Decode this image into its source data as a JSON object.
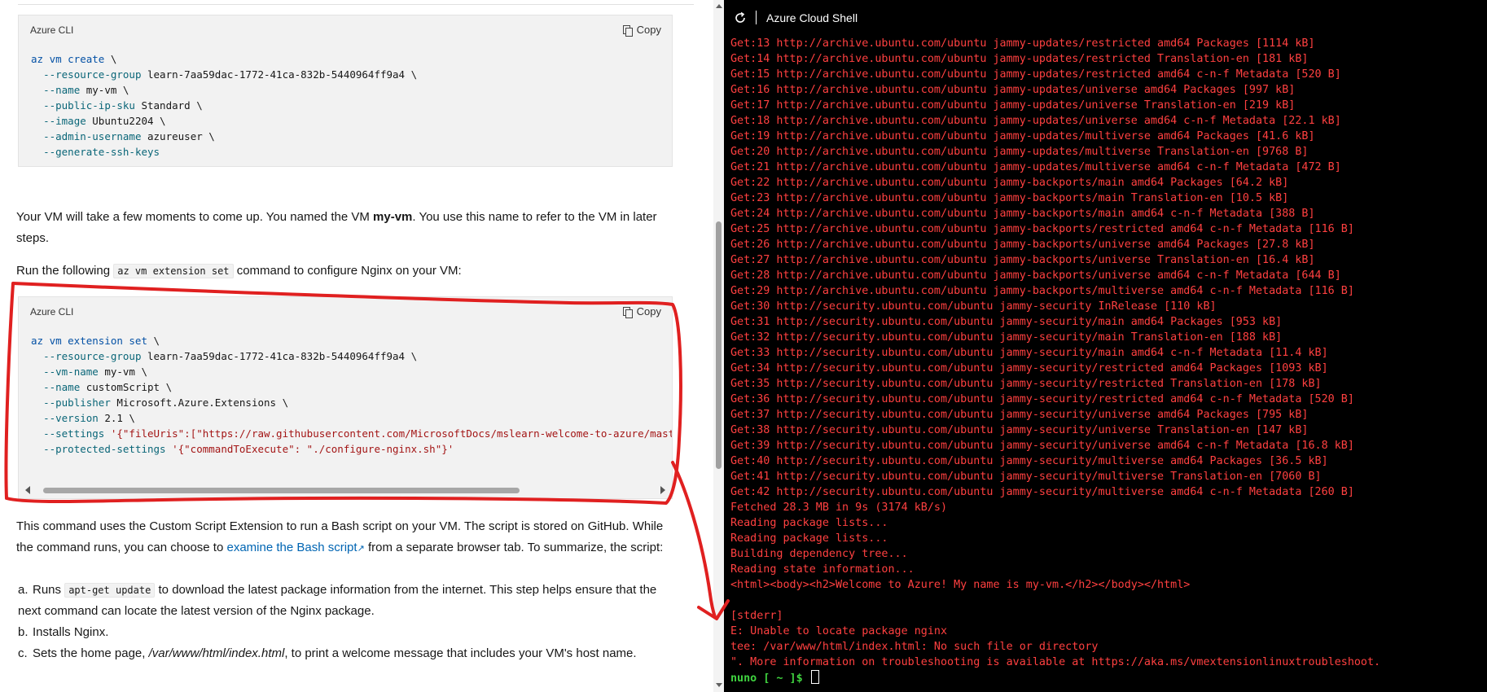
{
  "code1": {
    "lang": "Azure CLI",
    "copy": "Copy",
    "lines": [
      "az vm create \\",
      "  --resource-group learn-7aa59dac-1772-41ca-832b-5440964ff9a4 \\",
      "  --name my-vm \\",
      "  --public-ip-sku Standard \\",
      "  --image Ubuntu2204 \\",
      "  --admin-username azureuser \\",
      "  --generate-ssh-keys"
    ]
  },
  "para1": {
    "text_a": "Your VM will take a few moments to come up. You named the VM ",
    "bold": "my-vm",
    "text_b": ". You use this name to refer to the VM in later steps."
  },
  "para2": {
    "text_a": "Run the following ",
    "code": "az vm extension set",
    "text_b": " command to configure Nginx on your VM:"
  },
  "code2": {
    "lang": "Azure CLI",
    "copy": "Copy",
    "lines": [
      "az vm extension set \\",
      "  --resource-group learn-7aa59dac-1772-41ca-832b-5440964ff9a4 \\",
      "  --vm-name my-vm \\",
      "  --name customScript \\",
      "  --publisher Microsoft.Azure.Extensions \\",
      "  --version 2.1 \\",
      "  --settings '{\"fileUris\":[\"https://raw.githubusercontent.com/MicrosoftDocs/mslearn-welcome-to-azure/master/configure-nginx.sh\"]}' \\",
      "  --protected-settings '{\"commandToExecute\": \"./configure-nginx.sh\"}'"
    ]
  },
  "para3": {
    "text_a": "This command uses the Custom Script Extension to run a Bash script on your VM. The script is stored on GitHub. While the command runs, you can choose to ",
    "link": "examine the Bash script",
    "text_b": " from a separate browser tab. To summarize, the script:"
  },
  "list": [
    {
      "marker": "a.",
      "text_a": "Runs ",
      "code": "apt-get update",
      "text_b": " to download the latest package information from the internet. This step helps ensure that the next command can locate the latest version of the Nginx package."
    },
    {
      "marker": "b.",
      "text_a": "Installs Nginx.",
      "code": "",
      "text_b": ""
    },
    {
      "marker": "c.",
      "text_a": "Sets the home page, ",
      "code": "",
      "italic": "/var/www/html/index.html",
      "text_b": ", to print a welcome message that includes your VM's host name."
    }
  ],
  "shell": {
    "title": "Azure Cloud Shell",
    "lines": [
      "Get:13 http://archive.ubuntu.com/ubuntu jammy-updates/restricted amd64 Packages [1114 kB]",
      "Get:14 http://archive.ubuntu.com/ubuntu jammy-updates/restricted Translation-en [181 kB]",
      "Get:15 http://archive.ubuntu.com/ubuntu jammy-updates/restricted amd64 c-n-f Metadata [520 B]",
      "Get:16 http://archive.ubuntu.com/ubuntu jammy-updates/universe amd64 Packages [997 kB]",
      "Get:17 http://archive.ubuntu.com/ubuntu jammy-updates/universe Translation-en [219 kB]",
      "Get:18 http://archive.ubuntu.com/ubuntu jammy-updates/universe amd64 c-n-f Metadata [22.1 kB]",
      "Get:19 http://archive.ubuntu.com/ubuntu jammy-updates/multiverse amd64 Packages [41.6 kB]",
      "Get:20 http://archive.ubuntu.com/ubuntu jammy-updates/multiverse Translation-en [9768 B]",
      "Get:21 http://archive.ubuntu.com/ubuntu jammy-updates/multiverse amd64 c-n-f Metadata [472 B]",
      "Get:22 http://archive.ubuntu.com/ubuntu jammy-backports/main amd64 Packages [64.2 kB]",
      "Get:23 http://archive.ubuntu.com/ubuntu jammy-backports/main Translation-en [10.5 kB]",
      "Get:24 http://archive.ubuntu.com/ubuntu jammy-backports/main amd64 c-n-f Metadata [388 B]",
      "Get:25 http://archive.ubuntu.com/ubuntu jammy-backports/restricted amd64 c-n-f Metadata [116 B]",
      "Get:26 http://archive.ubuntu.com/ubuntu jammy-backports/universe amd64 Packages [27.8 kB]",
      "Get:27 http://archive.ubuntu.com/ubuntu jammy-backports/universe Translation-en [16.4 kB]",
      "Get:28 http://archive.ubuntu.com/ubuntu jammy-backports/universe amd64 c-n-f Metadata [644 B]",
      "Get:29 http://archive.ubuntu.com/ubuntu jammy-backports/multiverse amd64 c-n-f Metadata [116 B]",
      "Get:30 http://security.ubuntu.com/ubuntu jammy-security InRelease [110 kB]",
      "Get:31 http://security.ubuntu.com/ubuntu jammy-security/main amd64 Packages [953 kB]",
      "Get:32 http://security.ubuntu.com/ubuntu jammy-security/main Translation-en [188 kB]",
      "Get:33 http://security.ubuntu.com/ubuntu jammy-security/main amd64 c-n-f Metadata [11.4 kB]",
      "Get:34 http://security.ubuntu.com/ubuntu jammy-security/restricted amd64 Packages [1093 kB]",
      "Get:35 http://security.ubuntu.com/ubuntu jammy-security/restricted Translation-en [178 kB]",
      "Get:36 http://security.ubuntu.com/ubuntu jammy-security/restricted amd64 c-n-f Metadata [520 B]",
      "Get:37 http://security.ubuntu.com/ubuntu jammy-security/universe amd64 Packages [795 kB]",
      "Get:38 http://security.ubuntu.com/ubuntu jammy-security/universe Translation-en [147 kB]",
      "Get:39 http://security.ubuntu.com/ubuntu jammy-security/universe amd64 c-n-f Metadata [16.8 kB]",
      "Get:40 http://security.ubuntu.com/ubuntu jammy-security/multiverse amd64 Packages [36.5 kB]",
      "Get:41 http://security.ubuntu.com/ubuntu jammy-security/multiverse Translation-en [7060 B]",
      "Get:42 http://security.ubuntu.com/ubuntu jammy-security/multiverse amd64 c-n-f Metadata [260 B]",
      "Fetched 28.3 MB in 9s (3174 kB/s)",
      "Reading package lists...",
      "Reading package lists...",
      "Building dependency tree...",
      "Reading state information...",
      "<html><body><h2>Welcome to Azure! My name is my-vm.</h2></body></html>",
      "",
      "[stderr]",
      "E: Unable to locate package nginx",
      "tee: /var/www/html/index.html: No such file or directory",
      "\". More information on troubleshooting is available at https://aka.ms/vmextensionlinuxtroubleshoot."
    ],
    "prompt": "nuno [ ~ ]$ "
  },
  "colors": {
    "terminal_text": "#ff4040",
    "prompt": "#3fd23f",
    "annotation": "#e02020",
    "link": "#0065b3"
  }
}
